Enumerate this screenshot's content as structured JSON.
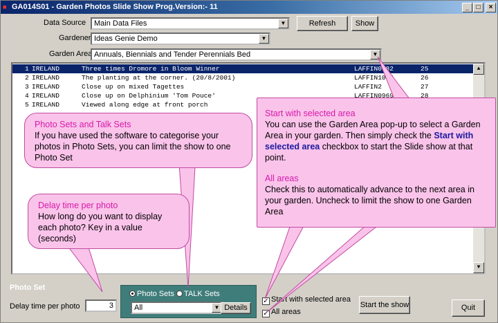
{
  "window": {
    "title": "GA014S01 - Garden Photos Slide Show    Prog.Version:-  11",
    "min_label": "_",
    "max_label": "□",
    "close_label": "×",
    "app_icon": "app-icon"
  },
  "form": {
    "data_source_label": "Data Source",
    "data_source_value": "Main Data Files",
    "refresh_label": "Refresh",
    "show_label": "Show",
    "gardener_label": "Gardener",
    "gardener_value": "Ideas Genie Demo",
    "garden_area_label": "Garden Area",
    "garden_area_value": "Annuals, Biennials and Tender Perennials Bed",
    "photo_set_label": "Photo Set",
    "delay_label": "Delay time per photo",
    "delay_value": "3",
    "radio_photo_sets": "Photo Sets",
    "radio_talk_sets": "TALK Sets",
    "set_value": "All",
    "details_label": "Details",
    "chk_start_selected": "Start with selected area",
    "chk_all_areas": "All areas",
    "start_show_label": "Start the show",
    "quit_label": "Quit",
    "arrow": "▼"
  },
  "list": {
    "rows": [
      {
        "num": "1",
        "country": "IRELAND",
        "caption": "Three times Dromore in Bloom Winner",
        "code": "LAFFIN0982",
        "n": "25"
      },
      {
        "num": "2",
        "country": "IRELAND",
        "caption": "The planting at the corner. (20/8/2001)",
        "code": "LAFFIN1015",
        "n": "26"
      },
      {
        "num": "3",
        "country": "IRELAND",
        "caption": "Close up on mixed Tagettes",
        "code": "LAFFIN2",
        "n": "27"
      },
      {
        "num": "4",
        "country": "IRELAND",
        "caption": "Close up on Delphinium 'Tom Pouce'",
        "code": "LAFFIN0969",
        "n": "28"
      },
      {
        "num": "5",
        "country": "IRELAND",
        "caption": "Viewed along edge at front porch",
        "code": "",
        "n": ""
      }
    ],
    "scroll_up": "▲",
    "scroll_down": "▼"
  },
  "callouts": {
    "photo_sets_title": "Photo Sets and Talk Sets",
    "photo_sets_text": "If you have used the software to categorise your photos in Photo Sets, you can limit the show to one Photo Set",
    "delay_title": "Delay time per photo",
    "delay_text": "How long do you want to display each photo? Key in a value (seconds)",
    "start_title": "Start with selected area",
    "start_text_a": "You can use the Garden Area pop-up to select a Garden Area in your garden. Then simply check the ",
    "start_text_bold": "Start with selected area",
    "start_text_b": " checkbox to start the Slide show at that point.",
    "all_title": "All areas",
    "all_text": "Check this to automatically advance to the next area in your garden. Uncheck to limit the show to one Garden Area"
  },
  "colors": {
    "selection": "#0a246a",
    "callout_fill": "#fac3ea",
    "callout_heading": "#d61aa9",
    "panel_teal": "#3f7d7a"
  }
}
